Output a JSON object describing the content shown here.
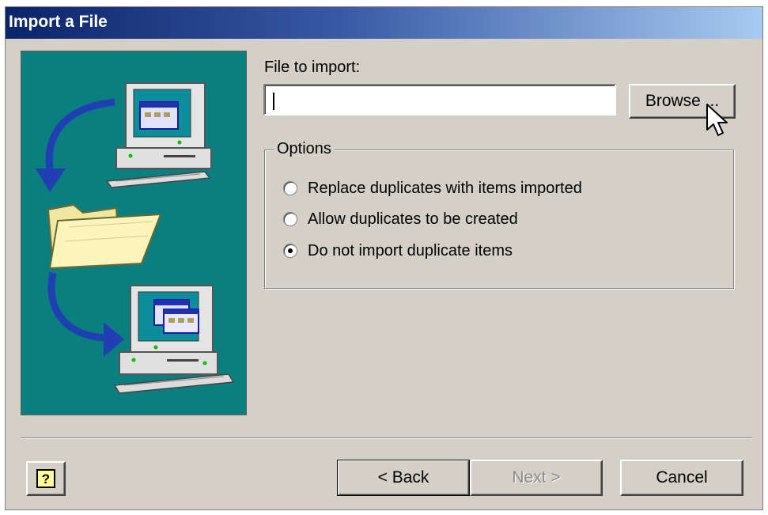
{
  "window": {
    "title": "Import a File"
  },
  "form": {
    "file_label": "File to import:",
    "file_value": "",
    "browse_label": "Browse ..."
  },
  "options": {
    "legend": "Options",
    "items": [
      {
        "label": "Replace duplicates with items imported",
        "checked": false
      },
      {
        "label": "Allow duplicates to be created",
        "checked": false
      },
      {
        "label": "Do not import duplicate items",
        "checked": true
      }
    ]
  },
  "footer": {
    "help_icon": "help-question-icon",
    "back_label": "< Back",
    "next_label": "Next >",
    "cancel_label": "Cancel"
  },
  "illustration": {
    "icons": [
      "computer-icon",
      "arrow-icon",
      "folder-icon",
      "computer-icon",
      "arrow-icon"
    ],
    "background_color": "#0b7f80"
  },
  "colors": {
    "title_gradient_start": "#0a246a",
    "title_gradient_end": "#a6caf0",
    "dialog_face": "#d4d0c8"
  }
}
